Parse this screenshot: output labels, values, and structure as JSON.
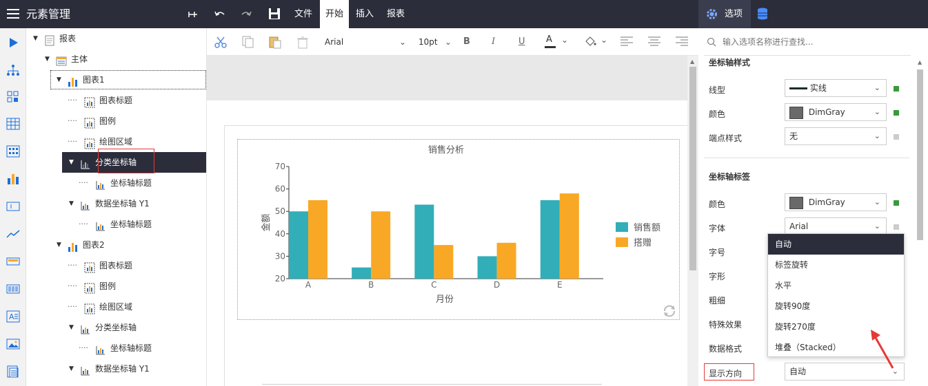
{
  "topbar": {
    "title": "元素管理",
    "menus": [
      "文件",
      "开始",
      "插入",
      "报表"
    ],
    "active_menu": "开始",
    "right_tab_options": "选项"
  },
  "tree": {
    "items": [
      {
        "label": "报表",
        "level": 0,
        "arrow": true
      },
      {
        "label": "主体",
        "level": 1,
        "arrow": true
      },
      {
        "label": "图表1",
        "level": 2,
        "arrow": true
      },
      {
        "label": "图表标题",
        "level": 3,
        "arrow": false
      },
      {
        "label": "图例",
        "level": 3,
        "arrow": false
      },
      {
        "label": "绘图区域",
        "level": 3,
        "arrow": false
      },
      {
        "label": "分类坐标轴",
        "level": 3,
        "arrow": true
      },
      {
        "label": "坐标轴标题",
        "level": 4,
        "arrow": false
      },
      {
        "label": "数据坐标轴 Y1",
        "level": 3,
        "arrow": true
      },
      {
        "label": "坐标轴标题",
        "level": 4,
        "arrow": false
      },
      {
        "label": "图表2",
        "level": 2,
        "arrow": true
      },
      {
        "label": "图表标题",
        "level": 3,
        "arrow": false
      },
      {
        "label": "图例",
        "level": 3,
        "arrow": false
      },
      {
        "label": "绘图区域",
        "level": 3,
        "arrow": false
      },
      {
        "label": "分类坐标轴",
        "level": 3,
        "arrow": true
      },
      {
        "label": "坐标轴标题",
        "level": 4,
        "arrow": false
      },
      {
        "label": "数据坐标轴 Y1",
        "level": 3,
        "arrow": true
      }
    ],
    "selected_index": 6
  },
  "toolbar": {
    "font_family": "Arial",
    "font_size": "10pt",
    "bold": "B",
    "italic": "I",
    "underline": "U",
    "font_color_glyph": "A"
  },
  "chart_data": {
    "type": "bar",
    "title": "销售分析",
    "xlabel": "月份",
    "ylabel": "金额",
    "categories": [
      "A",
      "B",
      "C",
      "D",
      "E"
    ],
    "series": [
      {
        "name": "销售额",
        "values": [
          50,
          25,
          53,
          30,
          55
        ],
        "color": "#31aeb8"
      },
      {
        "name": "搭赠",
        "values": [
          55,
          50,
          35,
          36,
          58
        ],
        "color": "#f9a825"
      }
    ],
    "ylim": [
      20,
      70
    ],
    "yticks": [
      20,
      30,
      40,
      50,
      60,
      70
    ],
    "legend_position": "right",
    "grid": false
  },
  "props": {
    "search_placeholder": "输入选项名称进行查找...",
    "section_axis_style": "坐标轴样式",
    "line_type_label": "线型",
    "line_type_value": "实线",
    "color_label": "颜色",
    "color_value": "DimGray",
    "endpoint_label": "端点样式",
    "endpoint_value": "无",
    "section_axis_label": "坐标轴标签",
    "label_color_label": "颜色",
    "label_color_value": "DimGray",
    "font_label": "字体",
    "font_value": "Arial",
    "size_label": "字号",
    "shape_label": "字形",
    "weight_label": "粗细",
    "effect_label": "特殊效果",
    "format_label": "数据格式",
    "direction_label": "显示方向",
    "direction_value": "自动",
    "dropdown_options": [
      "自动",
      "标签旋转",
      "水平",
      "旋转90度",
      "旋转270度",
      "堆叠（Stacked）"
    ],
    "dropdown_selected_index": 0,
    "accent_green": "#3a9a3a",
    "swatch_color": "#696969"
  }
}
